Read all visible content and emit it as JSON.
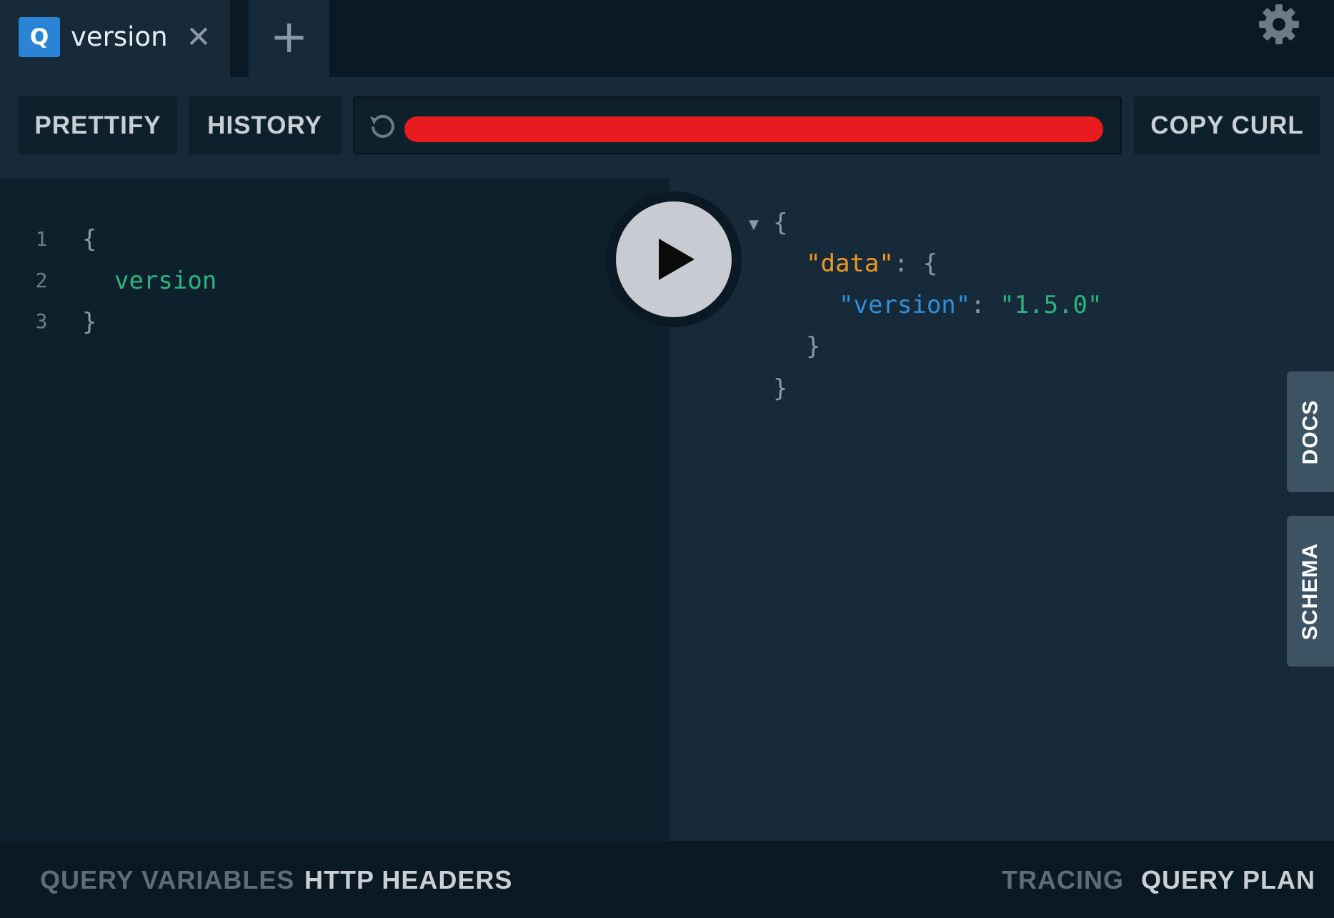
{
  "tabs": [
    {
      "badge": "Q",
      "title": "version",
      "close": "✕"
    }
  ],
  "add_tab": "+",
  "toolbar": {
    "prettify": "PRETTIFY",
    "history": "HISTORY",
    "url": "",
    "copy_curl": "COPY CURL"
  },
  "editor": {
    "lines": [
      {
        "num": "1",
        "text": "{"
      },
      {
        "num": "2",
        "text": "version"
      },
      {
        "num": "3",
        "text": "}"
      }
    ]
  },
  "result": {
    "open_brace": "{",
    "data_key": "\"data\"",
    "colon": ":",
    "data_open": "{",
    "version_key": "\"version\"",
    "version_value": "\"1.5.0\"",
    "data_close": "}",
    "close_brace": "}"
  },
  "side_tabs": {
    "docs": "DOCS",
    "schema": "SCHEMA"
  },
  "bottom": {
    "query_variables": "QUERY VARIABLES",
    "http_headers": "HTTP HEADERS",
    "tracing": "TRACING",
    "query_plan": "QUERY PLAN"
  },
  "colors": {
    "accent_blue": "#2a84d6",
    "field_green": "#2bb57e",
    "key_orange": "#f09a1c",
    "redaction_red": "#e81c1f"
  }
}
